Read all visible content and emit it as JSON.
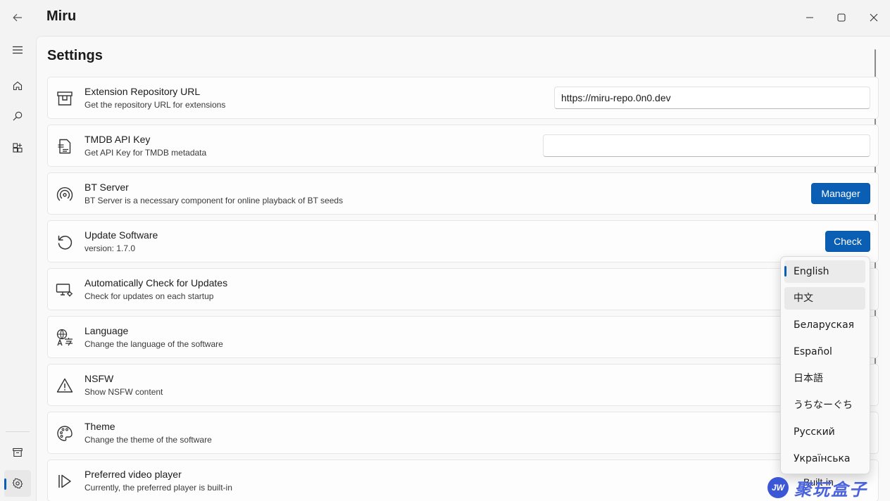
{
  "app": {
    "title": "Miru"
  },
  "page": {
    "title": "Settings"
  },
  "settings": [
    {
      "title": "Extension Repository URL",
      "desc": "Get the repository URL for extensions",
      "icon": "package-icon",
      "control": {
        "type": "input",
        "value": "https://miru-repo.0n0.dev"
      }
    },
    {
      "title": "TMDB API Key",
      "desc": "Get API Key for TMDB metadata",
      "icon": "document-key-icon",
      "control": {
        "type": "input",
        "value": ""
      }
    },
    {
      "title": "BT Server",
      "desc": "BT Server is a necessary component for online playback of BT seeds",
      "icon": "broadcast-icon",
      "control": {
        "type": "button",
        "label": "Manager"
      }
    },
    {
      "title": "Update Software",
      "desc": "version: 1.7.0",
      "icon": "refresh-icon",
      "control": {
        "type": "button",
        "label": "Check"
      }
    },
    {
      "title": "Automatically Check for Updates",
      "desc": "Check for updates on each startup",
      "icon": "monitor-settings-icon"
    },
    {
      "title": "Language",
      "desc": "Change the language of the software",
      "icon": "language-icon"
    },
    {
      "title": "NSFW",
      "desc": "Show NSFW content",
      "icon": "warning-icon"
    },
    {
      "title": "Theme",
      "desc": "Change the theme of the software",
      "icon": "palette-icon"
    },
    {
      "title": "Preferred video player",
      "desc": "Currently, the preferred player is built-in",
      "icon": "play-icon",
      "control": {
        "type": "select",
        "value": "Built-in"
      }
    }
  ],
  "language_dropdown": {
    "selected": "English",
    "options": [
      "English",
      "中文",
      "Беларуская",
      "Español",
      "日本語",
      "うちなーぐち",
      "Русский",
      "Українська"
    ]
  },
  "watermark": {
    "badge": "JW",
    "text": "聚玩盒子"
  },
  "colors": {
    "accent": "#0a5fb4",
    "background": "#f3f3f3",
    "card": "#fdfdfd"
  }
}
